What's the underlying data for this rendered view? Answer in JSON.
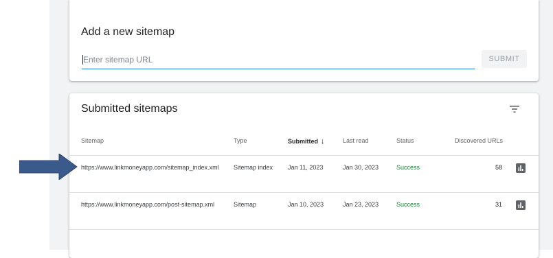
{
  "add_sitemap": {
    "title": "Add a new sitemap",
    "input_placeholder": "Enter sitemap URL",
    "input_value": "",
    "submit_label": "SUBMIT"
  },
  "submitted": {
    "title": "Submitted sitemaps",
    "filter_icon": "filter-icon",
    "columns": {
      "sitemap": "Sitemap",
      "type": "Type",
      "submitted": "Submitted",
      "last_read": "Last read",
      "status": "Status",
      "discovered": "Discovered URLs"
    },
    "sort_icon": "arrow-down-icon",
    "rows": [
      {
        "sitemap": "https://www.linkmoneyapp.com/sitemap_index.xml",
        "type": "Sitemap index",
        "submitted": "Jan 11, 2023",
        "last_read": "Jan 30, 2023",
        "status": "Success",
        "discovered": "58"
      },
      {
        "sitemap": "https://www.linkmoneyapp.com/post-sitemap.xml",
        "type": "Sitemap",
        "submitted": "Jan 10, 2023",
        "last_read": "Jan 23, 2023",
        "status": "Success",
        "discovered": "31"
      }
    ]
  },
  "colors": {
    "accent": "#1a73e8",
    "success": "#188038",
    "pointer": "#3b5a8c"
  },
  "annotation": {
    "pointer_icon": "arrow-right-icon"
  }
}
